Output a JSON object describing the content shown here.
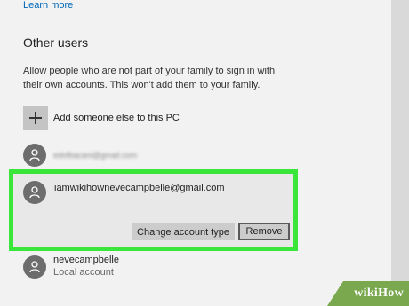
{
  "header": {
    "learn_more": "Learn more"
  },
  "other_users": {
    "title": "Other users",
    "description": "Allow people who are not part of your family to sign in with their own accounts. This won't add them to your family.",
    "add_label": "Add someone else to this PC",
    "users": [
      {
        "email": "edofbacani@gmail.com",
        "obscured": true
      },
      {
        "email": "iamwikihownevecampbelle@gmail.com",
        "selected": true,
        "change_button": "Change account type",
        "remove_button": "Remove"
      },
      {
        "name": "nevecampbelle",
        "type": "Local account"
      }
    ]
  },
  "watermark": "wikiHow",
  "colors": {
    "link": "#0067b8",
    "highlight": "#39e639",
    "panel_bg": "#f2f2f2",
    "button_bg": "#cccccc",
    "watermark_bg": "#7aa84f"
  },
  "icons": {
    "add": "plus-icon",
    "avatar": "user-avatar-icon"
  }
}
